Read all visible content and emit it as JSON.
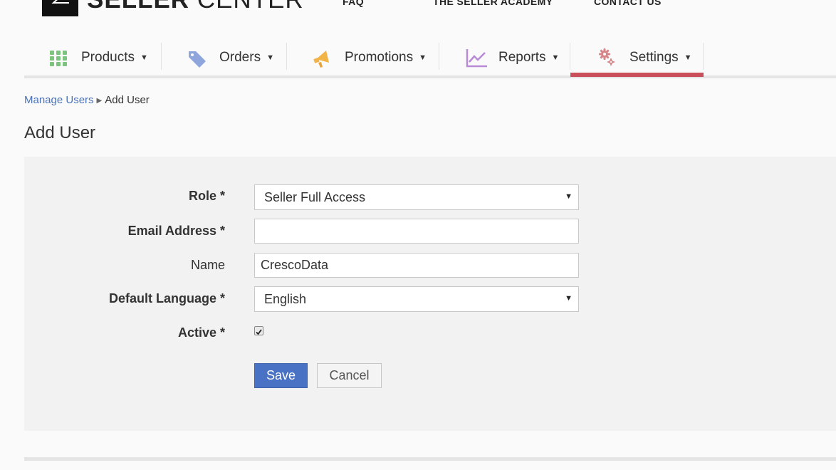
{
  "header": {
    "logo_bold": "SELLER",
    "logo_light": "CENTER",
    "links": [
      "FAQ",
      "THE SELLER ACADEMY",
      "CONTACT US"
    ]
  },
  "nav": {
    "items": [
      {
        "label": "Products",
        "icon": "grid-icon",
        "color": "#7cc47e"
      },
      {
        "label": "Orders",
        "icon": "tag-icon",
        "color": "#8ea6dc"
      },
      {
        "label": "Promotions",
        "icon": "megaphone-icon",
        "color": "#f2b347"
      },
      {
        "label": "Reports",
        "icon": "line-chart-icon",
        "color": "#b98ad6"
      },
      {
        "label": "Settings",
        "icon": "gears-icon",
        "color": "#d8858a"
      }
    ],
    "active": "Settings",
    "active_color": "#c9505a"
  },
  "breadcrumb": {
    "parent": "Manage Users",
    "current": "Add User"
  },
  "page": {
    "title": "Add User"
  },
  "form": {
    "role_label": "Role *",
    "role_value": "Seller Full Access",
    "email_label": "Email Address *",
    "email_value": "",
    "name_label": "Name",
    "name_value": "CrescoData",
    "language_label": "Default Language *",
    "language_value": "English",
    "active_label": "Active *",
    "active_checked": true,
    "save_label": "Save",
    "cancel_label": "Cancel"
  },
  "colors": {
    "primary_button": "#4a72c4",
    "link": "#4a72b8"
  }
}
